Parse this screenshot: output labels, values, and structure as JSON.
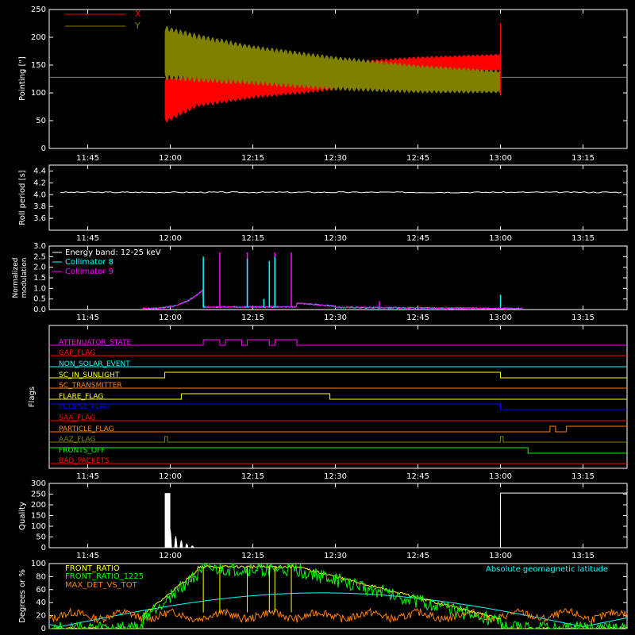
{
  "chart_data": [
    {
      "type": "line",
      "ylabel": "Pointing [\"]",
      "ylim": [
        0,
        250
      ],
      "yticks": [
        "0",
        "50",
        "100",
        "150",
        "200",
        "250"
      ],
      "xticks": [
        "11:45",
        "12:00",
        "12:15",
        "12:30",
        "12:45",
        "13:00",
        "13:15"
      ],
      "legend": [
        {
          "name": "X",
          "color": "#ff0000"
        },
        {
          "name": "Y",
          "color": "#808000"
        }
      ],
      "series": [
        {
          "name": "X",
          "color": "#ff0000",
          "x": [
            "11:59",
            "12:05",
            "12:15",
            "12:30",
            "12:45",
            "13:00"
          ],
          "band_low": [
            45,
            75,
            90,
            105,
            130,
            140
          ],
          "band_high": [
            130,
            135,
            140,
            155,
            165,
            170
          ]
        },
        {
          "name": "Y",
          "color": "#808000",
          "x": [
            "11:59",
            "12:05",
            "12:15",
            "12:30",
            "12:45",
            "13:00"
          ],
          "band_low": [
            125,
            120,
            115,
            105,
            100,
            100
          ],
          "band_high": [
            220,
            205,
            185,
            165,
            150,
            140
          ]
        }
      ],
      "baseline": 128,
      "spike_at": "13:00"
    },
    {
      "type": "line",
      "ylabel": "Roll period [s]",
      "ylim": [
        3.4,
        4.5
      ],
      "yticks": [
        "3.6",
        "3.8",
        "4.0",
        "4.2",
        "4.4"
      ],
      "xticks": [
        "11:45",
        "12:00",
        "12:15",
        "12:30",
        "12:45",
        "13:00",
        "13:15"
      ],
      "series": [
        {
          "name": "",
          "color": "#ffffff",
          "x": [
            "11:40",
            "13:22"
          ],
          "values": [
            4.04,
            4.04
          ]
        }
      ]
    },
    {
      "type": "line",
      "ylabel": "Normalized modulation",
      "ylabel_lines": [
        "Normalized",
        "modulation"
      ],
      "ylim": [
        0,
        3.0
      ],
      "yticks": [
        "0.0",
        "0.5",
        "1.0",
        "1.5",
        "2.0",
        "2.5",
        "3.0"
      ],
      "xticks": [
        "11:45",
        "12:00",
        "12:15",
        "12:30",
        "12:45",
        "13:00",
        "13:15"
      ],
      "legend_title": "Energy band: 12-25 keV",
      "series": [
        {
          "name": "Collimator 8",
          "color": "#00ffff"
        },
        {
          "name": "Collimator 9",
          "color": "#ff00ff"
        }
      ],
      "spikes_c8": [
        [
          "12:06",
          2.5
        ],
        [
          "12:14",
          2.4
        ],
        [
          "12:17",
          0.5
        ],
        [
          "12:18",
          2.3
        ],
        [
          "12:19",
          2.5
        ],
        [
          "13:00",
          0.7
        ]
      ],
      "spikes_c9": [
        [
          "12:09",
          2.7
        ],
        [
          "12:14",
          2.7
        ],
        [
          "12:19",
          2.7
        ],
        [
          "12:22",
          2.7
        ],
        [
          "12:38",
          0.4
        ]
      ]
    },
    {
      "type": "timeline",
      "ylabel": "Flags",
      "xticks": [
        "11:45",
        "12:00",
        "12:15",
        "12:30",
        "12:45",
        "13:00",
        "13:15"
      ],
      "flags": [
        {
          "name": "ATTENUATOR_STATE",
          "color": "#ff00ff"
        },
        {
          "name": "GAP_FLAG",
          "color": "#ff0000"
        },
        {
          "name": "NON_SOLAR_EVENT",
          "color": "#00ffff"
        },
        {
          "name": "SC_IN_SUNLIGHT",
          "color": "#ffff00"
        },
        {
          "name": "SC_TRANSMITTER",
          "color": "#ff8000"
        },
        {
          "name": "FLARE_FLAG",
          "color": "#ffff00"
        },
        {
          "name": "ECLIPSE_FLAG",
          "color": "#0000ff"
        },
        {
          "name": "SAA_FLAG",
          "color": "#ff0000"
        },
        {
          "name": "PARTICLE_FLAG",
          "color": "#ff8000"
        },
        {
          "name": "AAZ_FLAG",
          "color": "#808000"
        },
        {
          "name": "FRONTS_OFF",
          "color": "#00ff00"
        },
        {
          "name": "BAD_PACKETS",
          "color": "#ff0000"
        }
      ]
    },
    {
      "type": "bar",
      "ylabel": "Quality",
      "ylim": [
        0,
        300
      ],
      "yticks": [
        "0",
        "50",
        "100",
        "150",
        "200",
        "250",
        "300"
      ],
      "xticks": [
        "11:45",
        "12:00",
        "12:15",
        "12:30",
        "12:45",
        "13:00",
        "13:15"
      ],
      "series": [
        {
          "name": "",
          "color": "#ffffff"
        }
      ],
      "blocks": [
        [
          "11:59",
          "12:00",
          255
        ],
        [
          "13:00",
          "13:22",
          255
        ]
      ],
      "decay": [
        [
          "12:00",
          170
        ],
        [
          "12:01",
          110
        ],
        [
          "12:02",
          70
        ],
        [
          "12:03",
          40
        ],
        [
          "12:04",
          20
        ]
      ]
    },
    {
      "type": "line",
      "ylabel": "Degrees or %",
      "ylim": [
        0,
        100
      ],
      "yticks": [
        "0",
        "20",
        "40",
        "60",
        "80",
        "100"
      ],
      "xticks": [
        "11:45",
        "12:00",
        "12:15",
        "12:30",
        "12:45",
        "13:00",
        "13:15"
      ],
      "series": [
        {
          "name": "FRONT_RATIO",
          "color": "#ffff00"
        },
        {
          "name": "FRONT_RATIO_1225",
          "color": "#00ff00"
        },
        {
          "name": "MAX_DET_VS_TOT",
          "color": "#ff8000"
        },
        {
          "name": "Absolute geomagnetic latitude",
          "color": "#00ffff"
        }
      ]
    }
  ],
  "colors": {
    "background": "#000000",
    "axes": "#ffffff"
  }
}
